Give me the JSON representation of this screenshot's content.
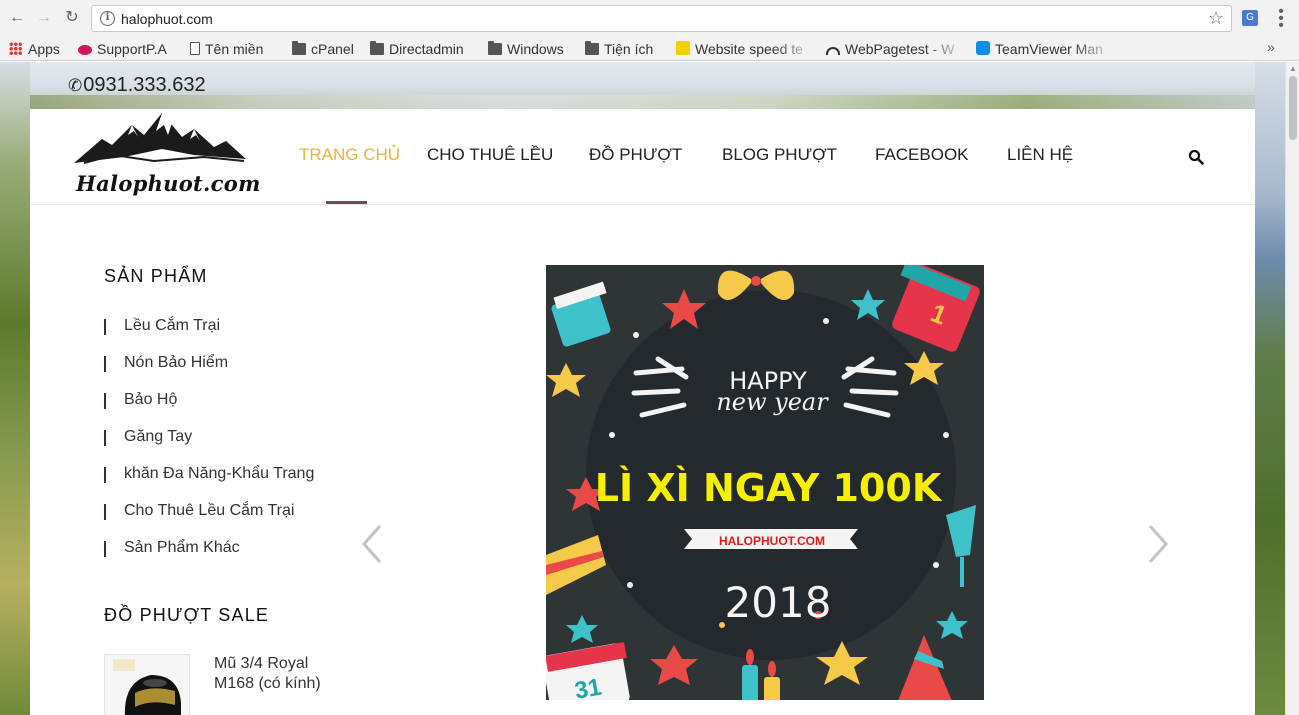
{
  "browser": {
    "url": "halophuot.com",
    "bookmarks": [
      {
        "label": "Apps",
        "icon": "apps-grid-icon"
      },
      {
        "label": "SupportP.A",
        "icon": "support-icon"
      },
      {
        "label": "Tên miền",
        "icon": "document-icon"
      },
      {
        "label": "cPanel",
        "icon": "folder-icon"
      },
      {
        "label": "Directadmin",
        "icon": "folder-icon"
      },
      {
        "label": "Windows",
        "icon": "folder-icon"
      },
      {
        "label": "Tiện ích",
        "icon": "folder-icon"
      },
      {
        "label": "Website speed te",
        "icon": "pingdom-icon"
      },
      {
        "label": "WebPagetest - W",
        "icon": "gauge-icon"
      },
      {
        "label": "TeamViewer Man",
        "icon": "teamviewer-icon"
      }
    ],
    "more": "»"
  },
  "site": {
    "phone": "0931.333.632",
    "logo_text": "Halophuot.com",
    "nav": [
      {
        "label": "TRANG CHỦ",
        "active": true
      },
      {
        "label": "CHO THUÊ LỀU"
      },
      {
        "label": "ĐỒ PHƯỢT"
      },
      {
        "label": "BLOG PHƯỢT"
      },
      {
        "label": "FACEBOOK"
      },
      {
        "label": "LIÊN HỆ"
      }
    ],
    "accent_color": "#e9b43a"
  },
  "sidebar": {
    "products_title": "SẢN PHẨM",
    "categories": [
      "Lều Cắm Trại",
      "Nón Bảo Hiểm",
      "Bảo Hộ",
      "Găng Tay",
      "khăn Đa Năng-Khẩu Trang",
      "Cho Thuê Lều Cắm Trại",
      "Sản Phẩm Khác"
    ],
    "sale_title": "ĐỒ PHƯỢT SALE",
    "sale_product": "Mũ 3/4 Royal M168 (có kính)"
  },
  "banner": {
    "happy": "HAPPY",
    "new_year": "new year",
    "headline": "LÌ XÌ NGAY 100K",
    "site": "HALOPHUOT.COM",
    "year": "2018",
    "calendar_top": "1",
    "calendar_bottom": "31"
  }
}
